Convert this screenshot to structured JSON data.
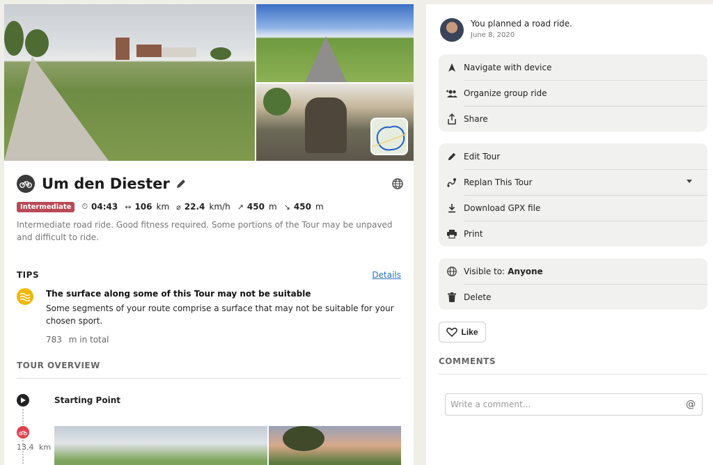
{
  "tour": {
    "title": "Um den Diester",
    "difficulty": "Intermediate",
    "stats": {
      "duration": "04:43",
      "distance": "106",
      "distance_unit": "km",
      "speed": "22.4",
      "speed_unit": "km/h",
      "uphill": "450",
      "uphill_unit": "m",
      "downhill": "450",
      "downhill_unit": "m"
    },
    "description": "Intermediate road ride. Good fitness required. Some portions of the Tour may be unpaved and difficult to ride."
  },
  "tips": {
    "heading": "TIPS",
    "details_link": "Details",
    "item": {
      "title": "The surface along some of this Tour may not be suitable",
      "body": "Some segments of your route comprise a surface that may not be suitable for your chosen sport.",
      "amount": "783",
      "amount_unit": "m in total"
    }
  },
  "overview": {
    "heading": "TOUR OVERVIEW",
    "start_label": "Starting Point",
    "segment_distance": "13.4",
    "segment_unit": "km"
  },
  "activity": {
    "text": "You planned a road ride.",
    "date": "June 8, 2020"
  },
  "actions": {
    "navigate": "Navigate with device",
    "group_ride": "Organize group ride",
    "share": "Share",
    "edit": "Edit Tour",
    "replan": "Replan This Tour",
    "download": "Download GPX file",
    "print": "Print",
    "visible_prefix": "Visible to:",
    "visible_value": "Anyone",
    "delete": "Delete"
  },
  "like_label": "Like",
  "comments": {
    "heading": "COMMENTS",
    "placeholder": "Write a comment...",
    "mention_symbol": "@"
  },
  "colors": {
    "difficulty_badge": "#b94a56",
    "tip_icon": "#f2b705",
    "segment_dot": "#e0424e",
    "link": "#2b6fbf"
  },
  "icons": {
    "sport": "road-bike-icon",
    "navigate": "navigation-arrow-icon",
    "group": "group-icon",
    "share": "share-icon",
    "edit": "pencil-icon",
    "replan": "route-icon",
    "download": "download-icon",
    "print": "printer-icon",
    "visibility": "globe-icon",
    "delete": "trash-icon",
    "like": "heart-icon"
  }
}
